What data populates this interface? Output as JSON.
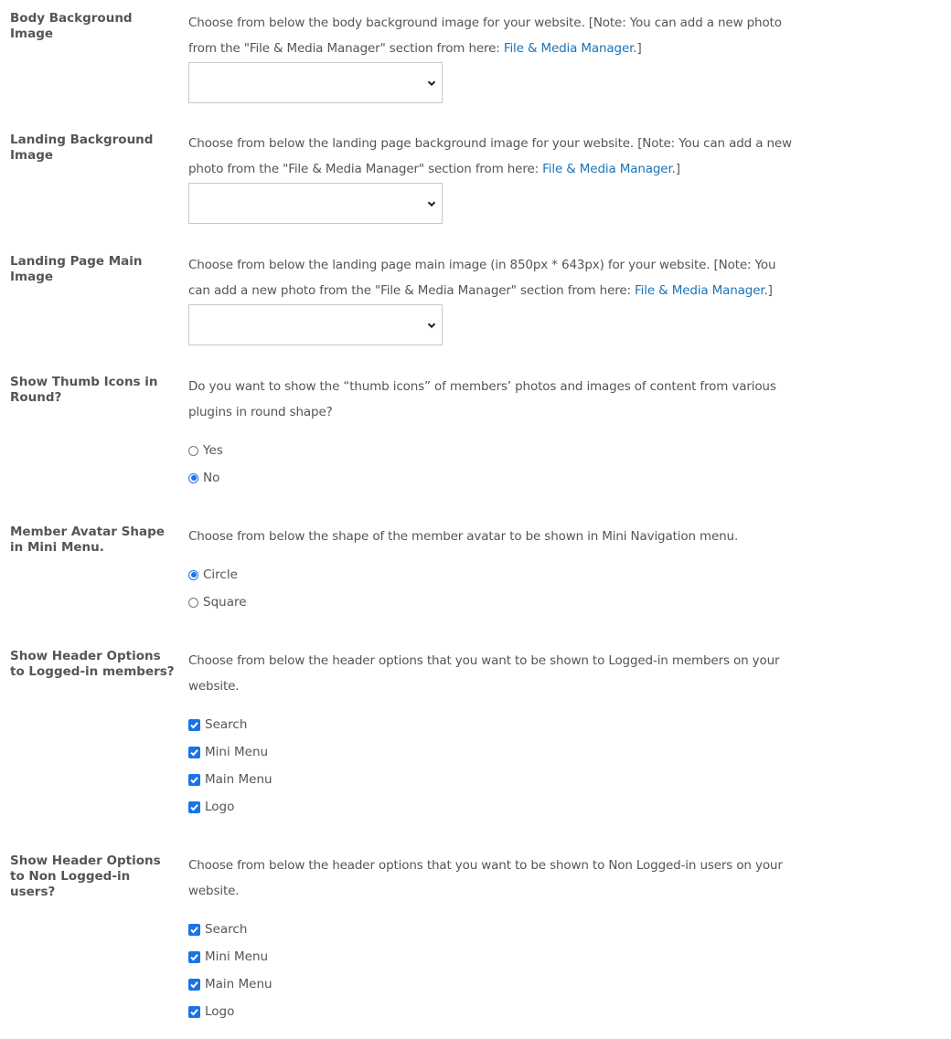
{
  "settings": [
    {
      "label": "Body Background Image",
      "desc_before": "Choose from below the body background image for your website. [Note: You can add a new photo from the \"File & Media Manager\" section from here: ",
      "link": "File & Media Manager",
      "desc_after": ".]",
      "select_value": ""
    },
    {
      "label": "Landing Background Image",
      "desc_before": "Choose from below the landing page background image for your website. [Note: You can add a new photo from the \"File & Media Manager\" section from here: ",
      "link": "File & Media Manager",
      "desc_after": ".]",
      "select_value": ""
    },
    {
      "label": "Landing Page Main Image",
      "desc_before": "Choose from below the landing page main image (in 850px * 643px) for your website. [Note: You can add a new photo from the \"File & Media Manager\" section from here: ",
      "link": "File & Media Manager",
      "desc_after": ".]",
      "select_value": ""
    },
    {
      "label": "Show Thumb Icons in Round?",
      "desc": "Do you want to show the “thumb icons” of members’ photos and images of content from various plugins in round shape?",
      "options": [
        {
          "label": "Yes",
          "selected": false
        },
        {
          "label": "No",
          "selected": true
        }
      ]
    },
    {
      "label": "Member Avatar Shape in Mini Menu.",
      "desc": "Choose from below the shape of the member avatar to be shown in Mini Navigation menu.",
      "options": [
        {
          "label": "Circle",
          "selected": true
        },
        {
          "label": "Square",
          "selected": false
        }
      ]
    },
    {
      "label": "Show Header Options to Logged-in members?",
      "desc": "Choose from below the header options that you want to be shown to Logged-in members on your website.",
      "checkboxes": [
        {
          "label": "Search",
          "checked": true
        },
        {
          "label": "Mini Menu",
          "checked": true
        },
        {
          "label": "Main Menu",
          "checked": true
        },
        {
          "label": "Logo",
          "checked": true
        }
      ]
    },
    {
      "label": "Show Header Options to Non Logged-in users?",
      "desc": "Choose from below the header options that you want to be shown to Non Logged-in users on your website.",
      "checkboxes": [
        {
          "label": "Search",
          "checked": true
        },
        {
          "label": "Mini Menu",
          "checked": true
        },
        {
          "label": "Main Menu",
          "checked": true
        },
        {
          "label": "Logo",
          "checked": true
        }
      ]
    }
  ],
  "colors": {
    "link": "#1a73b8",
    "accent": "#1a73e8",
    "text": "#555555"
  },
  "icons": {
    "select_chevron": "chevron-down-icon",
    "checkbox_mark": "checkmark-icon"
  }
}
